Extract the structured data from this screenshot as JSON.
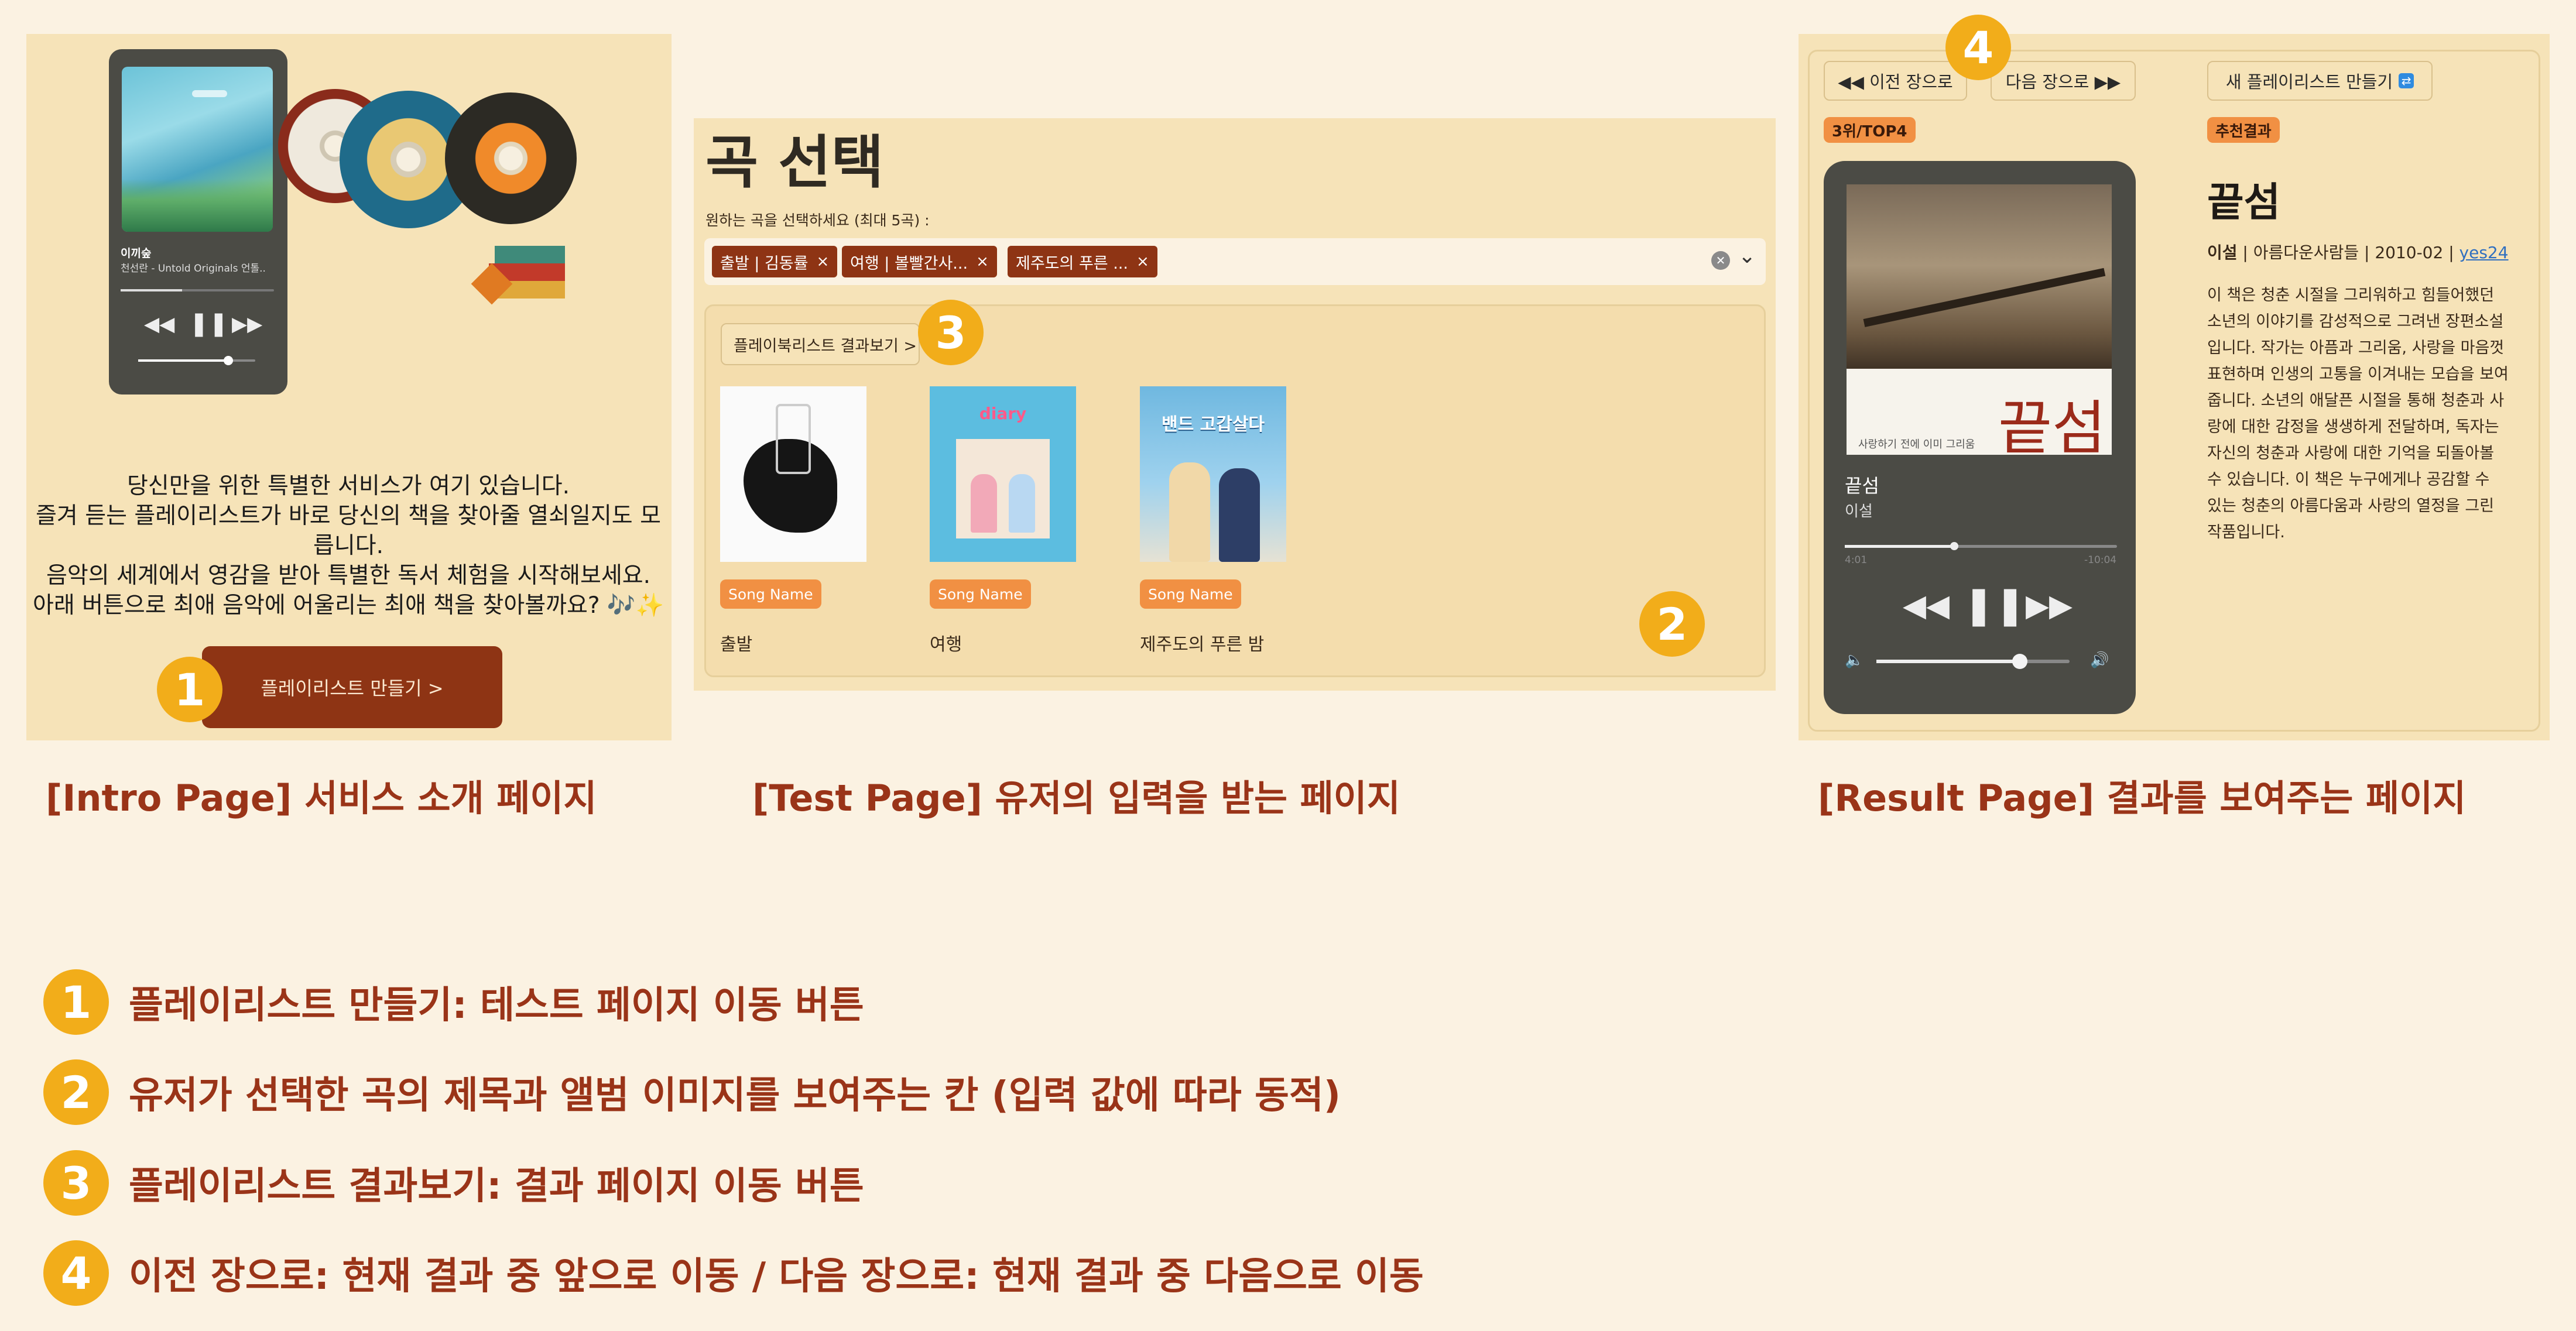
{
  "intro_page": {
    "player": {
      "song": "이끼숲",
      "artist": "천선란 - Untold Originals 언톨.."
    },
    "lines": [
      "당신만을 위한 특별한 서비스가 여기 있습니다.",
      "즐겨 듣는 플레이리스트가 바로 당신의 책을 찾아줄 열쇠일지도 모릅니다.",
      "음악의 세계에서 영감을 받아 특별한 독서 체험을 시작해보세요.",
      "아래 버튼으로 최애 음악에 어울리는 최애 책을 찾아볼까요? 🎶✨"
    ],
    "button_label": "플레이리스트 만들기 >",
    "caption": "[Intro Page] 서비스 소개 페이지"
  },
  "test_page": {
    "title": "곡 선택",
    "help_text": "원하는 곡을 선택하세요 (최대 5곡) :",
    "chips": [
      "출발 | 김동률",
      "여행 | 볼빨간사...",
      "제주도의 푸른 ..."
    ],
    "chip_remove": "×",
    "clear_icon": "✕",
    "dropdown_icon": "⌄",
    "result_button_label": "플레이북리스트 결과보기 >",
    "song_tag_label": "Song Name",
    "songs": [
      "출발",
      "여행",
      "제주도의 푸른 밤"
    ],
    "album_texts": [
      "",
      "diary",
      "밴드 고갑살다"
    ],
    "caption": "[Test Page] 유저의 입력을 받는 페이지"
  },
  "result_page": {
    "prev_label": "◀◀ 이전 장으로",
    "next_label": "다음 장으로 ▶▶",
    "new_playlist_label": "새 플레이리스트 만들기",
    "rank_tag": "3위/TOP4",
    "recommend_tag": "추천결과",
    "player_title": "끝섬",
    "player_artist": "이설",
    "time_elapsed": "4:01",
    "time_remaining": "-10:04",
    "cover_text": "끝섬",
    "cover_caption": "사랑하기 전에 이미 그리움",
    "book_title": "끝섬",
    "meta_author": "이설",
    "meta_rest": " | 아름다운사람들 | 2010-02 | ",
    "meta_link": "yes24",
    "description": "이 책은 청춘 시절을 그리워하고 힘들어했던 소년의 이야기를 감성적으로 그려낸 장편소설입니다. 작가는 아픔과 그리움, 사랑을 마음껏 표현하며 인생의 고통을 이겨내는 모습을 보여줍니다. 소년의 애달픈 시절을 통해 청춘과 사랑에 대한 감정을 생생하게 전달하며, 독자는 자신의 청춘과 사랑에 대한 기억을 되돌아볼 수 있습니다. 이 책은 누구에게나 공감할 수 있는 청춘의 아름다움과 사랑의 열정을 그린 작품입니다.",
    "caption": "[Result Page] 결과를 보여주는 페이지"
  },
  "badges": [
    "1",
    "2",
    "3",
    "4"
  ],
  "legend": [
    {
      "num": "1",
      "text": "플레이리스트 만들기: 테스트 페이지 이동 버튼"
    },
    {
      "num": "2",
      "text": "유저가 선택한 곡의 제목과 앨범 이미지를 보여주는 칸 (입력 값에 따라 동적)"
    },
    {
      "num": "3",
      "text": "플레이리스트 결과보기: 결과 페이지 이동 버튼"
    },
    {
      "num": "4",
      "text": "이전 장으로: 현재 결과 중 앞으로 이동 / 다음 장으로: 현재 결과 중 다음으로 이동"
    }
  ],
  "colors": {
    "accent": "#9a3418",
    "badge": "#f2ad1a",
    "panel": "#f6e3b8",
    "tag": "#f19043"
  }
}
